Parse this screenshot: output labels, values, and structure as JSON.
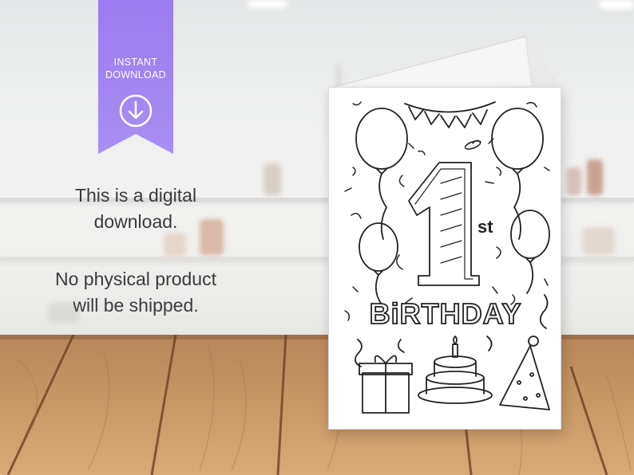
{
  "banner": {
    "line1": "INSTANT",
    "line2": "DOWNLOAD",
    "color_top": "#9b7bf0",
    "color_bottom": "#a98ef2",
    "icon": "download-arrow-icon"
  },
  "message": {
    "line1": "This is a digital",
    "line2": "download.",
    "line3": "No physical product",
    "line4": "will be shipped."
  },
  "card": {
    "number": "1",
    "suffix": "st",
    "word": "BiRTHDAY",
    "illustrations": [
      "balloon-icon",
      "bunting-icon",
      "gift-box-icon",
      "birthday-cake-icon",
      "party-hat-icon",
      "confetti"
    ]
  }
}
